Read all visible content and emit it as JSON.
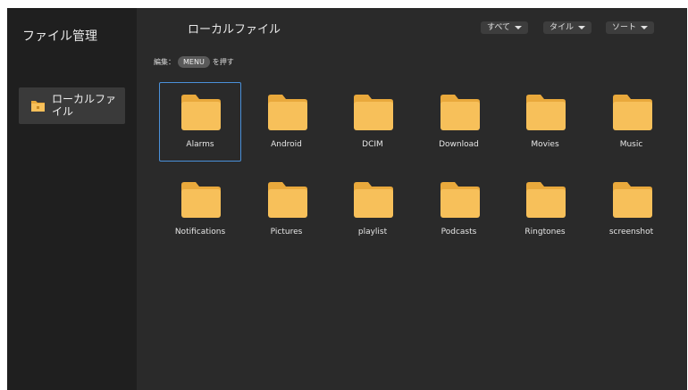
{
  "sidebar": {
    "title": "ファイル管理",
    "items": [
      {
        "label": "ローカルファイル",
        "icon": "folder-icon"
      }
    ]
  },
  "header": {
    "title": "ローカルファイル",
    "filters": [
      {
        "label": "すべて"
      },
      {
        "label": "タイル"
      },
      {
        "label": "ソート"
      }
    ]
  },
  "hint": {
    "prefix": "編集：",
    "key": "MENU",
    "suffix": "を押す"
  },
  "files": [
    {
      "name": "Alarms",
      "selected": true
    },
    {
      "name": "Android"
    },
    {
      "name": "DCIM"
    },
    {
      "name": "Download"
    },
    {
      "name": "Movies"
    },
    {
      "name": "Music"
    },
    {
      "name": "Notifications"
    },
    {
      "name": "Pictures"
    },
    {
      "name": "playlist"
    },
    {
      "name": "Podcasts"
    },
    {
      "name": "Ringtones"
    },
    {
      "name": "screenshot"
    }
  ],
  "colors": {
    "folder_body": "#f7c05a",
    "folder_tab": "#e9a93c",
    "selection_border": "#4a90d9"
  }
}
